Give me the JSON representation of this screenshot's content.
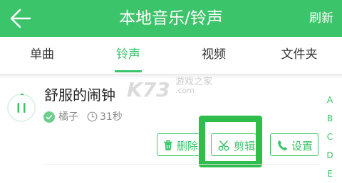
{
  "header": {
    "title": "本地音乐/铃声",
    "refresh_label": "刷新"
  },
  "tabs": [
    {
      "label": "单曲"
    },
    {
      "label": "铃声",
      "active": true
    },
    {
      "label": "视频"
    },
    {
      "label": "文件夹"
    }
  ],
  "song": {
    "title": "舒服的闹钟",
    "artist": "橘子",
    "duration": "31秒",
    "progress": 0.02
  },
  "actions": {
    "delete_label": "删除",
    "cut_label": "剪辑",
    "settings_label": "设置"
  },
  "index_letters": [
    "A",
    "B",
    "C",
    "D",
    "E"
  ],
  "watermark": {
    "logo": "K73",
    "text": "游戏之家",
    "url": ".com"
  },
  "colors": {
    "accent": "#3cc46a",
    "highlight": "#2fbd4d"
  }
}
